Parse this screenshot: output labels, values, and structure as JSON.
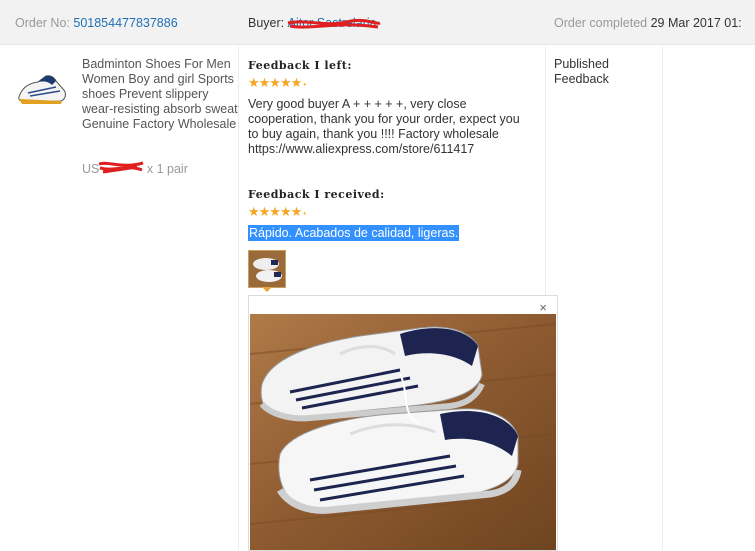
{
  "order": {
    "label": "Order No:",
    "number": "501854477837886",
    "buyer_label": "Buyer:",
    "buyer_name": "Aitor Sastrelaria",
    "completed_label": "Order completed",
    "completed_date": "29 Mar 2017 01:"
  },
  "product": {
    "title": "Badminton Shoes For Men Women Boy and girl Sports shoes Prevent slippery wear-resisting absorb sweat Genuine Factory Wholesale",
    "price_prefix": "US",
    "quantity": "x 1 pair",
    "thumbnail_icon": "shoe-thumbnail-image"
  },
  "feedback_left": {
    "heading": "Feedback I left:",
    "stars": "★★★★★",
    "rating": 5,
    "text": "Very good buyer A + + + + +, very close cooperation, thank you for your order, expect you to buy again, thank you !!!! Factory wholesale https://www.aliexpress.com/store/611417"
  },
  "feedback_received": {
    "heading": "Feedback I received:",
    "stars": "★★★★★",
    "rating": 5,
    "text": "Rápido. Acabados de calidad, ligeras."
  },
  "status": {
    "line1": "Published",
    "line2": "Feedback"
  },
  "popup": {
    "close_symbol": "×",
    "image_icon": "shoes-photo-image"
  },
  "colors": {
    "link": "#1f6fb5",
    "star": "#f5a623",
    "highlight": "#3390ff",
    "redaction": "#e02020"
  }
}
